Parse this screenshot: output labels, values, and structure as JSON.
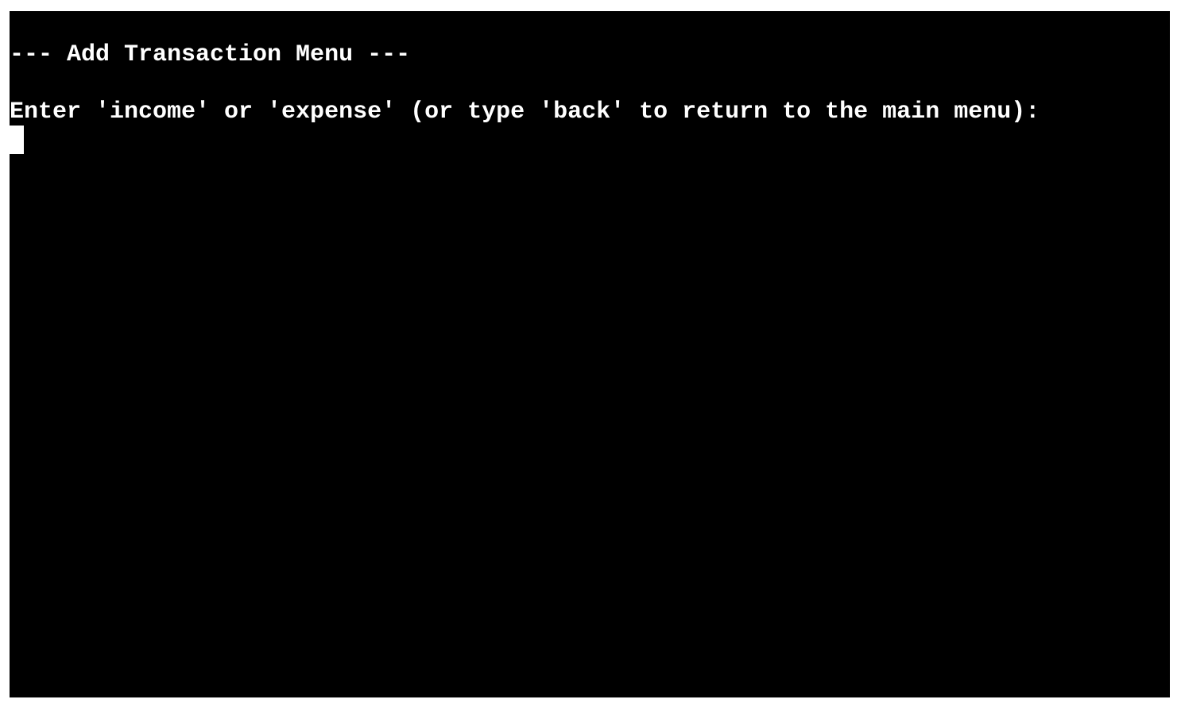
{
  "terminal": {
    "background": "#000000",
    "foreground": "#ffffff",
    "lines": [
      "--- Add Transaction Menu ---",
      "Enter 'income' or 'expense' (or type 'back' to return to the main menu):"
    ],
    "input_value": ""
  }
}
